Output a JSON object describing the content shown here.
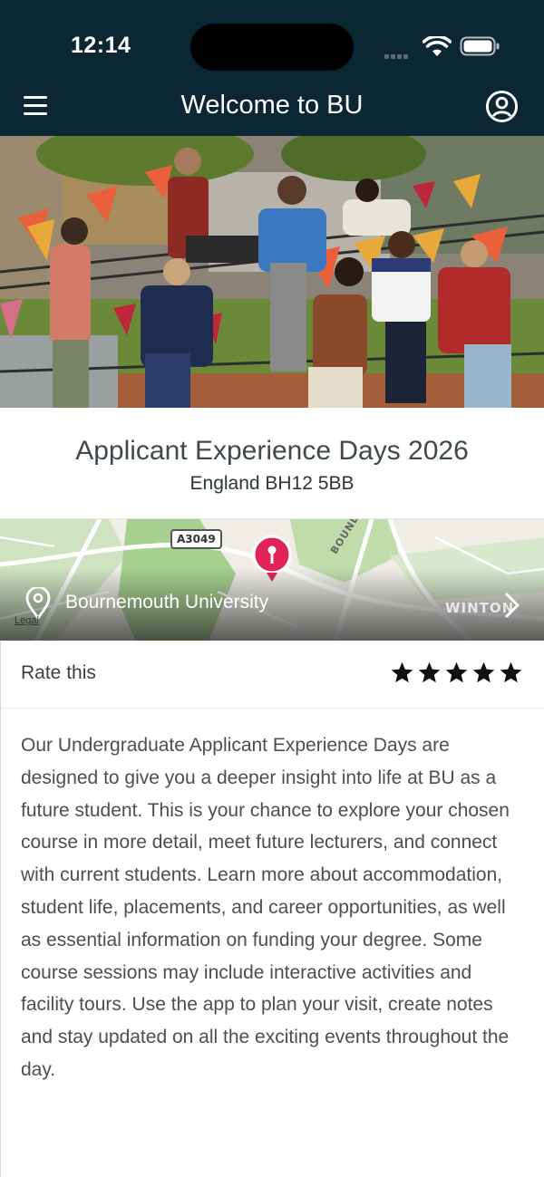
{
  "status_bar": {
    "time": "12:14"
  },
  "header": {
    "title": "Welcome to BU"
  },
  "event": {
    "title": "Applicant Experience Days 2026",
    "address": "England BH12 5BB"
  },
  "map": {
    "location_name": "Bournemouth University",
    "road_label": "A3049",
    "street_label": "BOUNDARY R",
    "area_label": "WINTON",
    "legal_label": "Legal"
  },
  "rating": {
    "label": "Rate this",
    "stars": 5
  },
  "description": "Our Undergraduate Applicant Experience Days are designed to give you a deeper insight into life at BU as a future student. This is your chance to explore your chosen course in more detail, meet future lecturers, and connect with current students. Learn more about accommodation, student life, placements, and career opportunities, as well as essential information on funding your degree. Some course sessions may include interactive activities and facility tours. Use the app to plan your visit, create notes and stay updated on all the exciting events throughout the day.",
  "colors": {
    "header_bg": "#0b2733",
    "pin": "#e0245a"
  }
}
